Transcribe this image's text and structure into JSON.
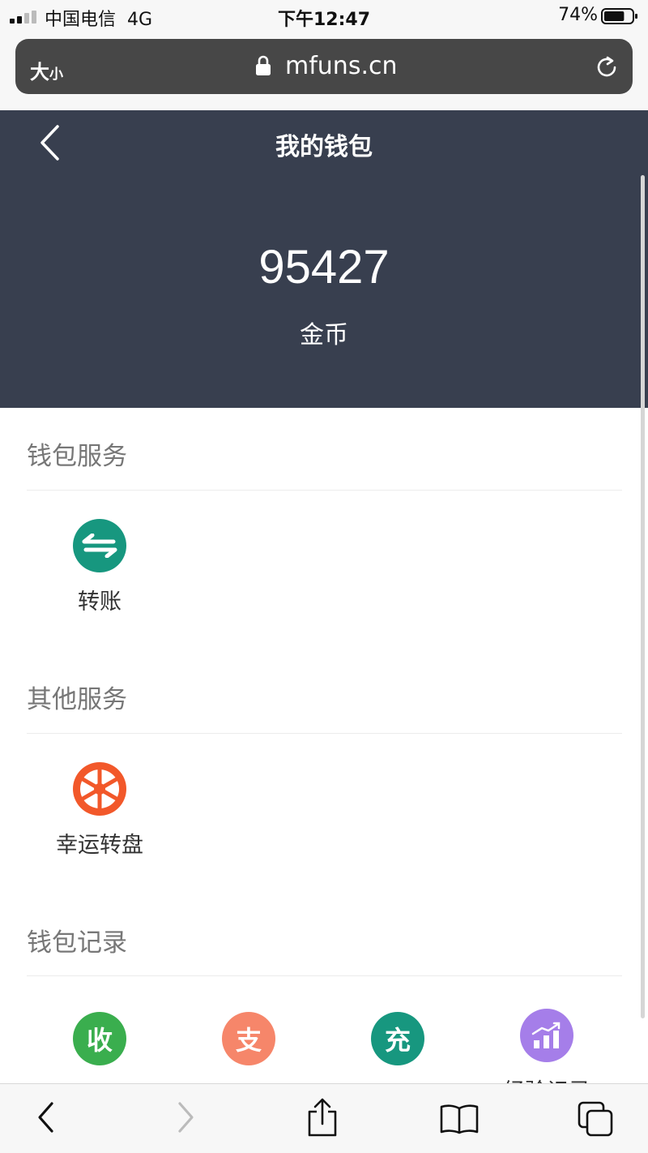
{
  "status_bar": {
    "carrier": "中国电信",
    "network": "4G",
    "time": "下午12:47",
    "battery": "74%",
    "battery_level": 0.74
  },
  "browser": {
    "text_size_label_big": "大",
    "text_size_label_small": "小",
    "url": "mfuns.cn"
  },
  "header": {
    "title": "我的钱包",
    "balance": "95427",
    "balance_unit": "金币"
  },
  "sections": {
    "wallet_services": {
      "title": "钱包服务",
      "items": [
        {
          "label": "转账",
          "icon": "transfer-icon",
          "color": "#17977f"
        }
      ]
    },
    "other_services": {
      "title": "其他服务",
      "items": [
        {
          "label": "幸运转盘",
          "icon": "lucky-wheel-icon",
          "color": "#f2582a"
        }
      ]
    },
    "wallet_records": {
      "title": "钱包记录",
      "items": [
        {
          "glyph": "收",
          "color": "#3aae4e"
        },
        {
          "glyph": "支",
          "color": "#f6866a"
        },
        {
          "glyph": "充",
          "color": "#17977f"
        },
        {
          "icon": "bar-chart-icon",
          "color": "#a57ee9",
          "label": "经验记录"
        }
      ]
    }
  }
}
